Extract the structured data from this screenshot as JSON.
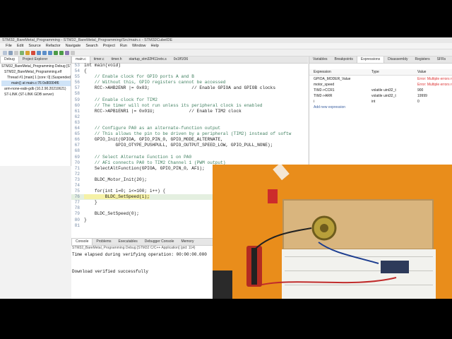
{
  "window": {
    "title": "STM32_BareMetal_Programming - STM32_BareMetal_Programming/Src/main.c - STM32CubeIDE"
  },
  "menu": [
    "File",
    "Edit",
    "Source",
    "Refactor",
    "Navigate",
    "Search",
    "Project",
    "Run",
    "Window",
    "Help"
  ],
  "debug_panel": {
    "tabs": [
      "Debug",
      "Project Explorer"
    ],
    "tree": [
      "STM32_BareMetal_Programming Debug [STM32 C/C++ Application]",
      "STM32_BareMetal_Programming.elf",
      "Thread #1 [main] 1 [core: 0] (Suspended : Breakpoint)",
      "main() at main.c:76 0x80004f6",
      "arm-none-eabi-gdb (10.2.90.20210621)",
      "ST-LINK (ST-LINK GDB server)"
    ]
  },
  "editor": {
    "tabs": [
      "main.c",
      "timer.c",
      "timer.h",
      "startup_stm32f411retx.s",
      "0x1ff1f36"
    ],
    "lines": [
      {
        "n": "53",
        "text": "int main(void)"
      },
      {
        "n": "54",
        "text": "{"
      },
      {
        "n": "55",
        "text": "    // Enable clock for GPIO ports A and B"
      },
      {
        "n": "56",
        "text": "    // Without this, GPIO registers cannot be accessed"
      },
      {
        "n": "57",
        "text": "    RCC->AHB2ENR |= 0x03;                // Enable GPIOA and GPIOB clocks"
      },
      {
        "n": "58",
        "text": ""
      },
      {
        "n": "59",
        "text": "    // Enable clock for TIM2"
      },
      {
        "n": "60",
        "text": "    // The timer will not run unless its peripheral clock is enabled"
      },
      {
        "n": "61",
        "text": "    RCC->APB1ENR1 |= 0x01U;             // Enable TIM2 clock"
      },
      {
        "n": "62",
        "text": ""
      },
      {
        "n": "63",
        "text": ""
      },
      {
        "n": "64",
        "text": "    // Configure PA0 as an alternate-function output"
      },
      {
        "n": "65",
        "text": "    // This allows the pin to be driven by a peripheral (TIM2) instead of softw"
      },
      {
        "n": "66",
        "text": "    GPIO_Init(GPIOA, GPIO_PIN_0, GPIO_MODE_ALTERNATE,"
      },
      {
        "n": "67",
        "text": "            GPIO_OTYPE_PUSHPULL, GPIO_OUTPUT_SPEED_LOW, GPIO_PULL_NONE);"
      },
      {
        "n": "68",
        "text": ""
      },
      {
        "n": "69",
        "text": "    // Select Alternate Function 1 on PA0"
      },
      {
        "n": "70",
        "text": "    // AF1 connects PA0 to TIM2 Channel 1 (PWM output)"
      },
      {
        "n": "71",
        "text": "    SelectAltFunction(GPIOA, GPIO_PIN_0, AF1);"
      },
      {
        "n": "72",
        "text": ""
      },
      {
        "n": "73",
        "text": "    BLDC_Motor_Init(20);"
      },
      {
        "n": "74",
        "text": ""
      },
      {
        "n": "75",
        "text": "    for(int i=0; i<=100; i++) {"
      },
      {
        "n": "76",
        "text": "        BLDC_SetSpeed(i);"
      },
      {
        "n": "77",
        "text": "    }"
      },
      {
        "n": "78",
        "text": ""
      },
      {
        "n": "79",
        "text": "    BLDC_SetSpeed(0);"
      },
      {
        "n": "80",
        "text": "}"
      },
      {
        "n": "81",
        "text": ""
      }
    ],
    "current_line": "76"
  },
  "expressions": {
    "tabs": [
      "Variables",
      "Breakpoints",
      "Expressions",
      "Disassembly",
      "Registers",
      "SFRs"
    ],
    "headers": [
      "Expression",
      "Type",
      "Value"
    ],
    "rows": [
      {
        "expr": "GPIOA_MODER_Value",
        "type": "",
        "value": "Error: Multiple errors reported"
      },
      {
        "expr": "motor_speed",
        "type": "",
        "value": "Error: Multiple errors reported"
      },
      {
        "expr": "TIM2->CCR1",
        "type": "volatile uint32_t",
        "value": "900"
      },
      {
        "expr": "TIM2->ARR",
        "type": "volatile uint32_t",
        "value": "19999"
      },
      {
        "expr": "i",
        "type": "int",
        "value": "0"
      }
    ],
    "add_label": "Add new expression"
  },
  "console": {
    "tabs": [
      "Console",
      "Problems",
      "Executables",
      "Debugger Console",
      "Memory"
    ],
    "subtitle": "STM32_BareMetal_Programming Debug [STM32 C/C++ Application] (pid: 114)",
    "lines": [
      "Time elapsed during verifying operation: 00:00:00.000",
      "",
      "",
      "Download verified successfully"
    ]
  },
  "colors": {
    "accent": "#3f7f5f",
    "error": "#dd3333",
    "photo_bg": "#e98d1b"
  }
}
